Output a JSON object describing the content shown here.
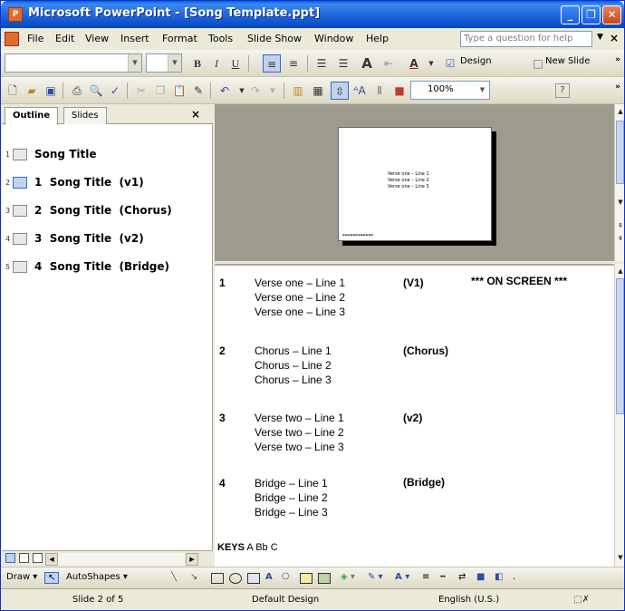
{
  "window": {
    "title": "Microsoft PowerPoint - [Song Template.ppt]",
    "minimize": "_",
    "restore": "❐",
    "close": "✕"
  },
  "menubar": {
    "items": [
      "File",
      "Edit",
      "View",
      "Insert",
      "Format",
      "Tools",
      "Slide Show",
      "Window",
      "Help"
    ],
    "help_placeholder": "Type a question for help",
    "close": "×"
  },
  "formatting_toolbar": {
    "bold": "B",
    "italic": "I",
    "underline": "U",
    "design_label": "Design",
    "new_slide_label": "New Slide"
  },
  "standard_toolbar": {
    "zoom": "100%",
    "help_icon": "?"
  },
  "outline_pane": {
    "tabs": [
      "Outline",
      "Slides"
    ],
    "active_tab": "Outline",
    "close": "×",
    "slides": [
      {
        "num": "1",
        "title": "Song Title",
        "selected": false
      },
      {
        "num": "2",
        "title": "1  Song Title  (v1)",
        "selected": true
      },
      {
        "num": "3",
        "title": "2  Song Title  (Chorus)",
        "selected": false
      },
      {
        "num": "4",
        "title": "3  Song Title  (v2)",
        "selected": false
      },
      {
        "num": "5",
        "title": "4  Song Title  (Bridge)",
        "selected": false
      }
    ]
  },
  "slide_preview": {
    "lines": [
      "Verse one – Line 1",
      "Verse one – Line 2",
      "Verse one – Line 3"
    ]
  },
  "notes": {
    "sections": [
      {
        "num": "1",
        "lines": [
          "Verse one – Line 1",
          "Verse one – Line 2",
          "Verse one – Line 3"
        ],
        "label": "(V1)"
      },
      {
        "num": "2",
        "lines": [
          "Chorus – Line 1",
          "Chorus – Line 2",
          "Chorus – Line 3"
        ],
        "label": "(Chorus)"
      },
      {
        "num": "3",
        "lines": [
          "Verse two – Line 1",
          "Verse two – Line 2",
          "Verse two – Line 3"
        ],
        "label": "(v2)"
      },
      {
        "num": "4",
        "lines": [
          "Bridge – Line 1",
          "Bridge – Line 2",
          "Bridge – Line 3"
        ],
        "label": "(Bridge)"
      }
    ],
    "on_screen": "*** ON SCREEN ***",
    "keys_label": "KEYS",
    "keys_value": "A Bb C"
  },
  "drawing_toolbar": {
    "draw_label": "Draw",
    "autoshapes_label": "AutoShapes"
  },
  "statusbar": {
    "slide_info": "Slide 2 of 5",
    "design": "Default Design",
    "language": "English (U.S.)"
  }
}
